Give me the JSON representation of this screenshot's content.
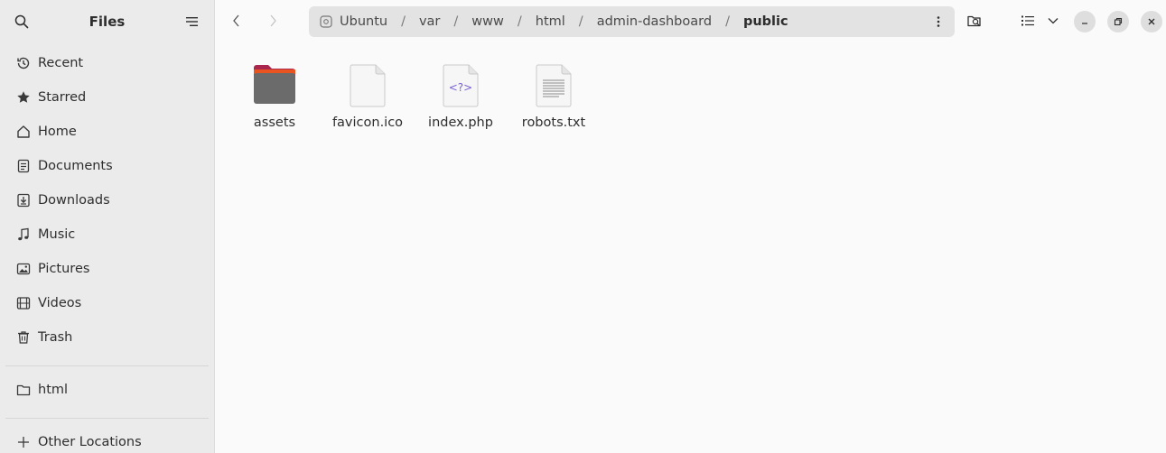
{
  "sidebar": {
    "title": "Files",
    "items": [
      {
        "label": "Recent",
        "icon": "clock-icon"
      },
      {
        "label": "Starred",
        "icon": "star-icon"
      },
      {
        "label": "Home",
        "icon": "home-icon"
      },
      {
        "label": "Documents",
        "icon": "document-icon"
      },
      {
        "label": "Downloads",
        "icon": "download-icon"
      },
      {
        "label": "Music",
        "icon": "music-icon"
      },
      {
        "label": "Pictures",
        "icon": "picture-icon"
      },
      {
        "label": "Videos",
        "icon": "video-icon"
      },
      {
        "label": "Trash",
        "icon": "trash-icon"
      }
    ],
    "bookmarks": [
      {
        "label": "html",
        "icon": "folder-icon"
      }
    ],
    "other_locations": {
      "label": "Other Locations",
      "icon": "plus-icon"
    }
  },
  "pathbar": {
    "crumbs": [
      "Ubuntu",
      "var",
      "www",
      "html",
      "admin-dashboard",
      "public"
    ],
    "separator": "/"
  },
  "files": [
    {
      "name": "assets",
      "type": "folder"
    },
    {
      "name": "favicon.ico",
      "type": "image-file"
    },
    {
      "name": "index.php",
      "type": "php-file"
    },
    {
      "name": "robots.txt",
      "type": "text-file"
    }
  ],
  "colors": {
    "folder_accent": "#e95420",
    "folder_tab": "#a9264f",
    "folder_body": "#6b6b6b",
    "php_glyph": "#7a5fd0"
  }
}
